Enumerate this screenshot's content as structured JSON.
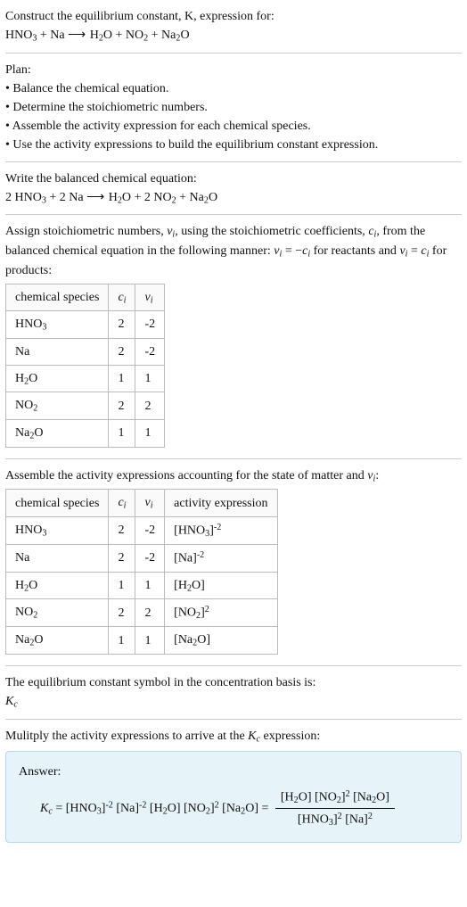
{
  "intro": {
    "line1": "Construct the equilibrium constant, K, expression for:",
    "eq_lhs": "HNO₃ + Na",
    "eq_arrow": "⟶",
    "eq_rhs": "H₂O + NO₂ + Na₂O"
  },
  "plan": {
    "heading": "Plan:",
    "items": [
      "Balance the chemical equation.",
      "Determine the stoichiometric numbers.",
      "Assemble the activity expression for each chemical species.",
      "Use the activity expressions to build the equilibrium constant expression."
    ]
  },
  "balanced": {
    "heading": "Write the balanced chemical equation:",
    "eq_lhs": "2 HNO₃ + 2 Na",
    "eq_arrow": "⟶",
    "eq_rhs": "H₂O + 2 NO₂ + Na₂O"
  },
  "assign": {
    "text_a": "Assign stoichiometric numbers, νᵢ, using the stoichiometric coefficients, cᵢ, from the balanced chemical equation in the following manner: νᵢ = −cᵢ for reactants and νᵢ = cᵢ for products:",
    "headers": [
      "chemical species",
      "cᵢ",
      "νᵢ"
    ],
    "rows": [
      {
        "sp": "HNO₃",
        "c": "2",
        "v": "-2"
      },
      {
        "sp": "Na",
        "c": "2",
        "v": "-2"
      },
      {
        "sp": "H₂O",
        "c": "1",
        "v": "1"
      },
      {
        "sp": "NO₂",
        "c": "2",
        "v": "2"
      },
      {
        "sp": "Na₂O",
        "c": "1",
        "v": "1"
      }
    ]
  },
  "activity": {
    "heading": "Assemble the activity expressions accounting for the state of matter and νᵢ:",
    "headers": [
      "chemical species",
      "cᵢ",
      "νᵢ",
      "activity expression"
    ],
    "rows": [
      {
        "sp": "HNO₃",
        "c": "2",
        "v": "-2",
        "a": "[HNO₃]⁻²"
      },
      {
        "sp": "Na",
        "c": "2",
        "v": "-2",
        "a": "[Na]⁻²"
      },
      {
        "sp": "H₂O",
        "c": "1",
        "v": "1",
        "a": "[H₂O]"
      },
      {
        "sp": "NO₂",
        "c": "2",
        "v": "2",
        "a": "[NO₂]²"
      },
      {
        "sp": "Na₂O",
        "c": "1",
        "v": "1",
        "a": "[Na₂O]"
      }
    ]
  },
  "kc_symbol": {
    "line1": "The equilibrium constant symbol in the concentration basis is:",
    "line2": "K_c"
  },
  "multiply": {
    "heading": "Mulitply the activity expressions to arrive at the K_c expression:"
  },
  "answer": {
    "label": "Answer:",
    "lhs": "K_c = [HNO₃]⁻² [Na]⁻² [H₂O] [NO₂]² [Na₂O] =",
    "frac_num": "[H₂O] [NO₂]² [Na₂O]",
    "frac_den": "[HNO₃]² [Na]²"
  }
}
